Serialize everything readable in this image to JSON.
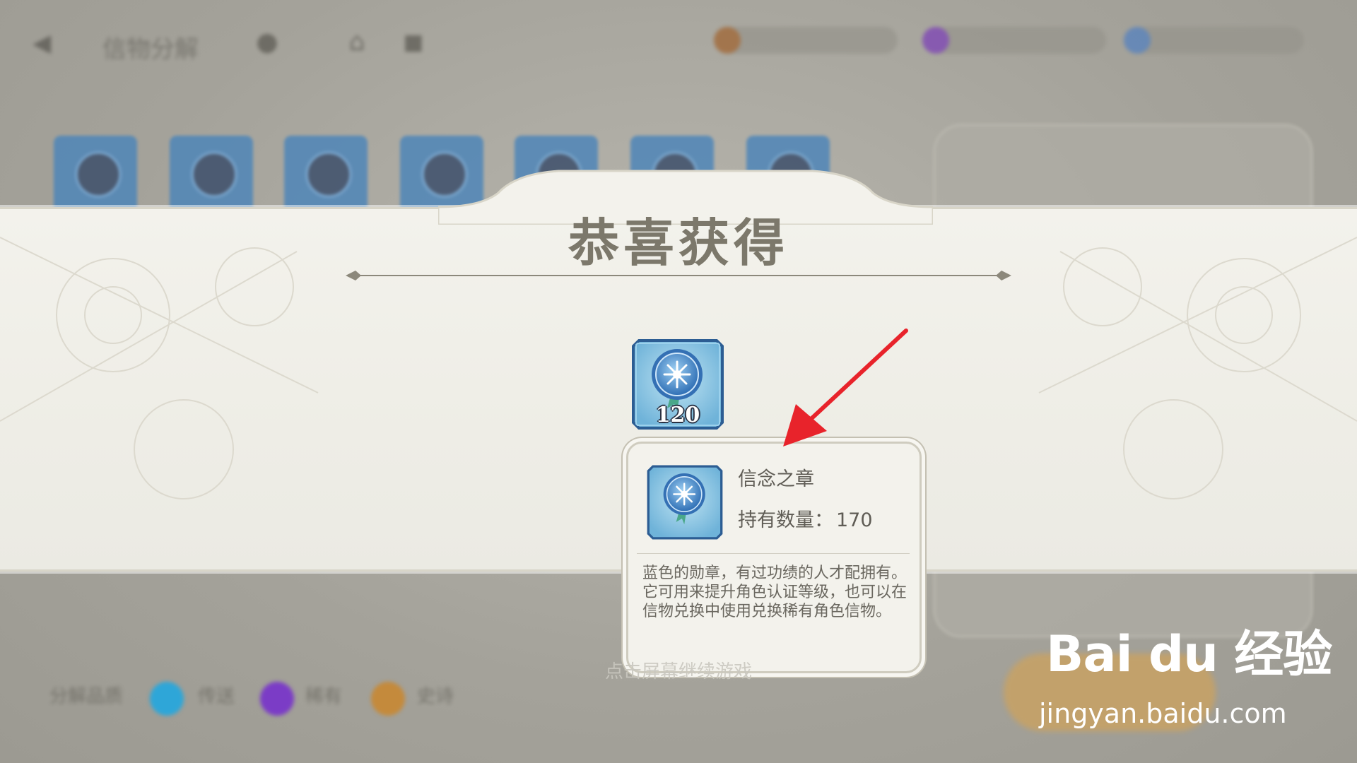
{
  "background": {
    "title": "信物分解",
    "continue_hint": "点击屏幕继续游戏",
    "legend": [
      "传送",
      "稀有",
      "史诗"
    ],
    "legend_label": "分解品质"
  },
  "banner": {
    "title": "恭喜获得"
  },
  "reward": {
    "icon": "badge-of-faith-icon",
    "count": "120"
  },
  "tooltip": {
    "item_name": "信念之章",
    "owned_label": "持有数量：",
    "owned_value": "170",
    "description_1": "蓝色的勋章，有过功绩的人才配拥有。",
    "description_2": "它可用来提升角色认证等级，也可以在信物兑换中使用兑换稀有角色信物。"
  },
  "watermark": {
    "logo": "Bai du 经验",
    "url": "jingyan.baidu.com"
  },
  "colors": {
    "annotation_arrow": "#e8232b",
    "title": "#7c786b",
    "badge_blue": "#3c7fc4"
  }
}
